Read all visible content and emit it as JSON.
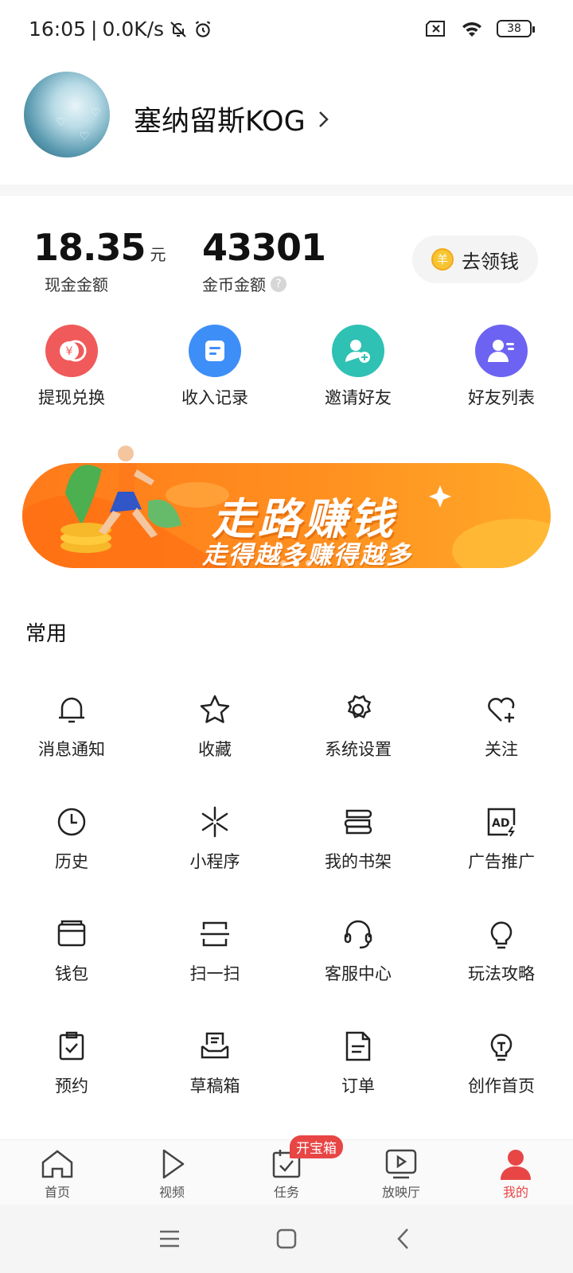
{
  "status": {
    "time": "16:05",
    "speed": "0.0K/s",
    "battery": "38"
  },
  "profile": {
    "username": "塞纳留斯KOG"
  },
  "balances": {
    "cash_value": "18.35",
    "cash_unit": "元",
    "cash_label": "现金金额",
    "coin_value": "43301",
    "coin_label": "金币金额",
    "claim_label": "去领钱",
    "claim_coin_glyph": "羊"
  },
  "quick_actions": [
    {
      "label": "提现兑换",
      "icon": "yuan-coin-icon",
      "color": "#f05a5a"
    },
    {
      "label": "收入记录",
      "icon": "record-icon",
      "color": "#3e8ef7"
    },
    {
      "label": "邀请好友",
      "icon": "add-user-icon",
      "color": "#2ec1b4"
    },
    {
      "label": "好友列表",
      "icon": "user-list-icon",
      "color": "#6d63f2"
    }
  ],
  "banner": {
    "title": "走路赚钱",
    "subtitle": "走得越多赚得越多"
  },
  "common": {
    "title": "常用",
    "items": [
      {
        "label": "消息通知",
        "icon": "bell-icon"
      },
      {
        "label": "收藏",
        "icon": "star-icon"
      },
      {
        "label": "系统设置",
        "icon": "gear-icon"
      },
      {
        "label": "关注",
        "icon": "heart-plus-icon"
      },
      {
        "label": "历史",
        "icon": "clock-icon"
      },
      {
        "label": "小程序",
        "icon": "mini-program-icon"
      },
      {
        "label": "我的书架",
        "icon": "bookshelf-icon"
      },
      {
        "label": "广告推广",
        "icon": "ad-icon"
      },
      {
        "label": "钱包",
        "icon": "wallet-icon"
      },
      {
        "label": "扫一扫",
        "icon": "scan-icon"
      },
      {
        "label": "客服中心",
        "icon": "headset-icon"
      },
      {
        "label": "玩法攻略",
        "icon": "lightbulb-icon"
      },
      {
        "label": "预约",
        "icon": "clipboard-check-icon"
      },
      {
        "label": "草稿箱",
        "icon": "draft-box-icon"
      },
      {
        "label": "订单",
        "icon": "document-icon"
      },
      {
        "label": "创作首页",
        "icon": "creator-bulb-icon"
      }
    ]
  },
  "tabs": [
    {
      "label": "首页",
      "icon": "home-icon"
    },
    {
      "label": "视频",
      "icon": "play-icon"
    },
    {
      "label": "任务",
      "icon": "task-icon",
      "badge": "开宝箱"
    },
    {
      "label": "放映厅",
      "icon": "screening-icon"
    },
    {
      "label": "我的",
      "icon": "user-icon",
      "active": true
    }
  ],
  "colors": {
    "accent": "#e84545",
    "banner_orange": "#ff8f1f"
  }
}
